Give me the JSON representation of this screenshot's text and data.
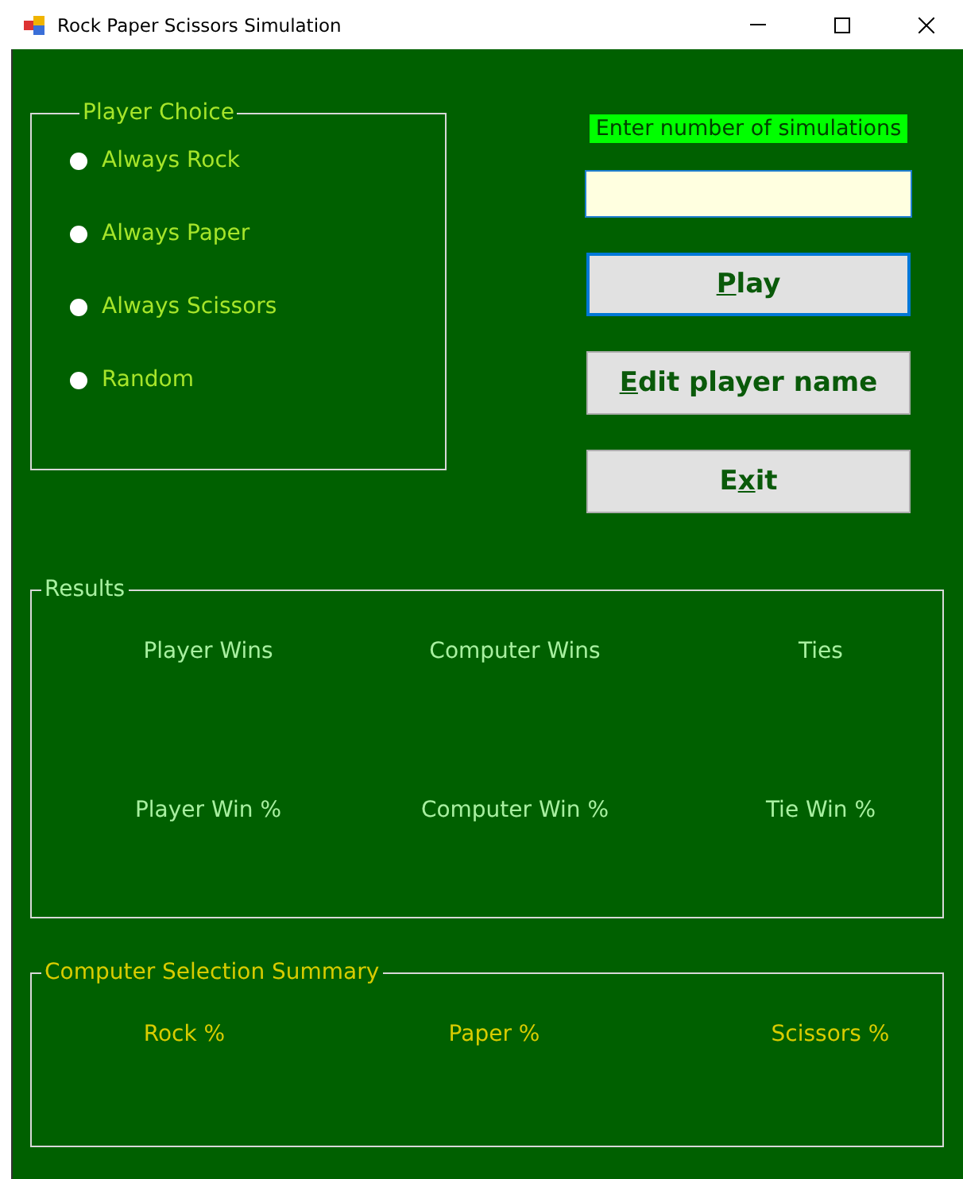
{
  "window": {
    "title": "Rock Paper Scissors Simulation"
  },
  "player_choice": {
    "title": "Player Choice",
    "options": [
      {
        "label": "Always Rock",
        "selected": false
      },
      {
        "label": "Always Paper",
        "selected": false
      },
      {
        "label": "Always Scissors",
        "selected": false
      },
      {
        "label": "Random",
        "selected": false
      }
    ]
  },
  "simulations": {
    "label": "Enter number of simulations"
  },
  "buttons": [
    {
      "key": "P",
      "after": "lay",
      "focused": true
    },
    {
      "key": "E",
      "after": "dit player name",
      "focused": false
    },
    {
      "before": "E",
      "key": "x",
      "after": "it",
      "focused": false
    }
  ],
  "results": {
    "title": "Results",
    "labels": [
      "Player Wins",
      "Computer Wins",
      "Ties",
      "Player Win %",
      "Computer Win %",
      "Tie Win %"
    ]
  },
  "summary": {
    "title": "Computer Selection Summary",
    "labels": [
      "Rock %",
      "Paper %",
      "Scissors %"
    ]
  }
}
